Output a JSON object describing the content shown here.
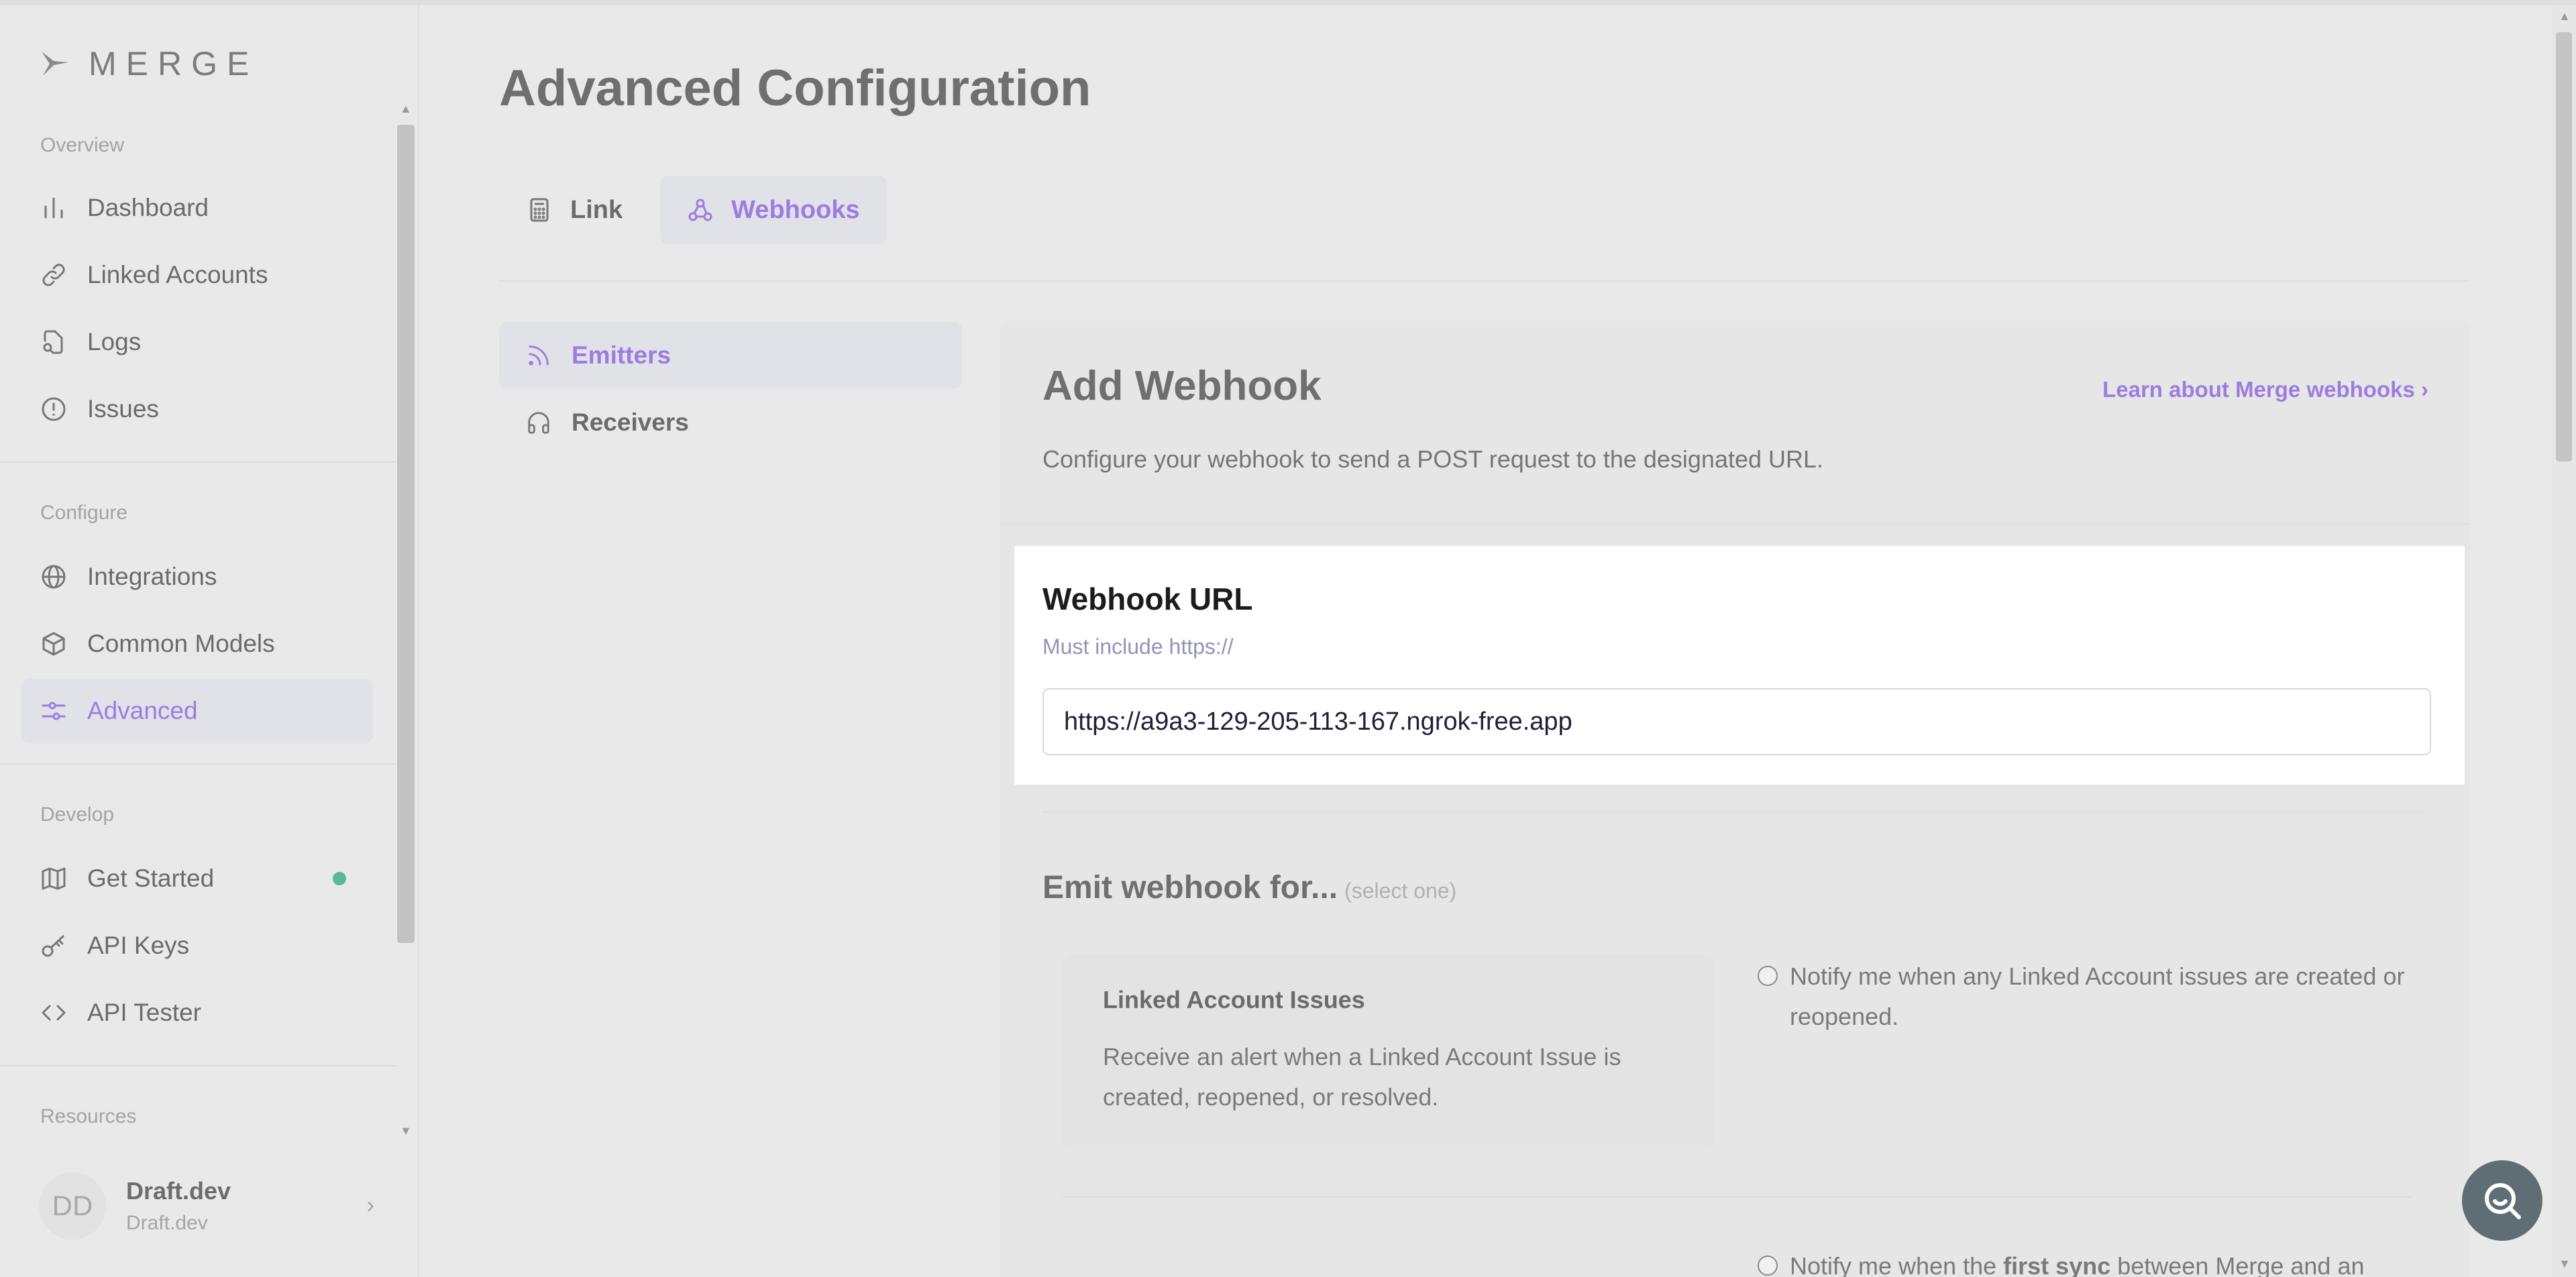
{
  "app": {
    "logo_text": "MERGE"
  },
  "sidebar": {
    "sections": [
      "Overview",
      "Configure",
      "Develop",
      "Resources"
    ],
    "items": [
      {
        "label": "Dashboard",
        "icon": "bar-chart-icon"
      },
      {
        "label": "Linked Accounts",
        "icon": "link-icon"
      },
      {
        "label": "Logs",
        "icon": "file-search-icon"
      },
      {
        "label": "Issues",
        "icon": "alert-circle-icon"
      },
      {
        "label": "Integrations",
        "icon": "globe-icon"
      },
      {
        "label": "Common Models",
        "icon": "cube-icon"
      },
      {
        "label": "Advanced",
        "icon": "sliders-icon",
        "active": true
      },
      {
        "label": "Get Started",
        "icon": "map-icon",
        "status": "green-dot"
      },
      {
        "label": "API Keys",
        "icon": "key-icon"
      },
      {
        "label": "API Tester",
        "icon": "code-icon"
      }
    ],
    "profile": {
      "initials": "DD",
      "name": "Draft.dev",
      "org": "Draft.dev"
    }
  },
  "main": {
    "title": "Advanced Configuration",
    "tabs": [
      {
        "label": "Link",
        "icon": "calculator-icon"
      },
      {
        "label": "Webhooks",
        "icon": "webhook-icon",
        "active": true
      }
    ],
    "subnav": [
      {
        "label": "Emitters",
        "icon": "rss-icon",
        "active": true
      },
      {
        "label": "Receivers",
        "icon": "headphones-icon"
      }
    ]
  },
  "card": {
    "title": "Add Webhook",
    "learn_link": "Learn about Merge webhooks",
    "description": "Configure your webhook to send a POST request to the designated URL.",
    "url_label": "Webhook URL",
    "url_hint": "Must include https://",
    "url_value": "https://a9a3-129-205-113-167.ngrok-free.app",
    "emit_title": "Emit webhook for...",
    "emit_hint": "(select one)",
    "option1": {
      "title": "Linked Account Issues",
      "description": "Receive an alert when a Linked Account Issue is created, reopened, or resolved.",
      "radio_label": "Notify me when any Linked Account issues are created or reopened."
    },
    "option2": {
      "radio_prefix": "Notify me when the ",
      "radio_bold": "first sync",
      "radio_suffix": " between Merge and an"
    }
  },
  "colors": {
    "accent": "#9b7de0",
    "status_green": "#5bb89a"
  }
}
